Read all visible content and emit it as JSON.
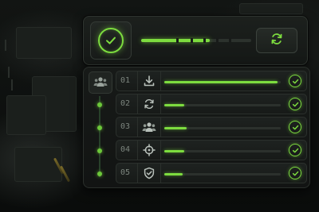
{
  "colors": {
    "accent": "#7ddc3f",
    "panel": "#171a18",
    "track": "#2c312d"
  },
  "header": {
    "status_icon": "check-circle-icon",
    "progress": 0.62,
    "refresh_icon": "refresh-icon"
  },
  "tasks": {
    "group_icon": "users-icon",
    "items": [
      {
        "number": "01",
        "icon": "download-icon",
        "progress": 0.97,
        "status_icon": "check-circle-icon"
      },
      {
        "number": "02",
        "icon": "refresh-icon",
        "progress": 0.17,
        "status_icon": "check-circle-icon"
      },
      {
        "number": "03",
        "icon": "users-icon",
        "progress": 0.19,
        "status_icon": "check-circle-icon"
      },
      {
        "number": "04",
        "icon": "target-icon",
        "progress": 0.17,
        "status_icon": "check-circle-icon"
      },
      {
        "number": "05",
        "icon": "shield-check-icon",
        "progress": 0.16,
        "status_icon": "check-circle-icon"
      }
    ]
  }
}
